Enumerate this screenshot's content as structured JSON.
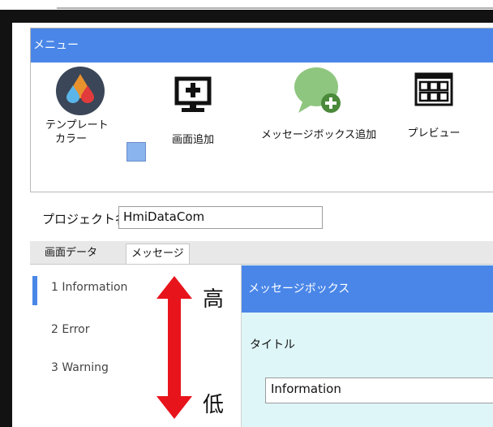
{
  "menu": {
    "header": "メニュー",
    "template_color_label_1": "テンプレート",
    "template_color_label_2": "カラー",
    "add_screen_label": "画面追加",
    "add_message_box_label": "メッセージボックス追加",
    "preview_label": "プレビュー"
  },
  "project": {
    "label": "プロジェクト名",
    "value": "HmiDataCom"
  },
  "tabs": [
    {
      "label": "画面データ",
      "active": false
    },
    {
      "label": "メッセージ",
      "active": true
    }
  ],
  "message_list": [
    {
      "label": "1 Information",
      "selected": true
    },
    {
      "label": "2 Error",
      "selected": false
    },
    {
      "label": "3 Warning",
      "selected": false
    }
  ],
  "detail": {
    "header": "メッセージボックス",
    "title_label": "タイトル",
    "title_value": "Information"
  },
  "annotation": {
    "high": "高",
    "low": "低"
  },
  "colors": {
    "accent": "#4a86e8",
    "swatch": "#8ab4ee",
    "detail_bg": "#dff6f8",
    "arrow": "#e8141c"
  }
}
